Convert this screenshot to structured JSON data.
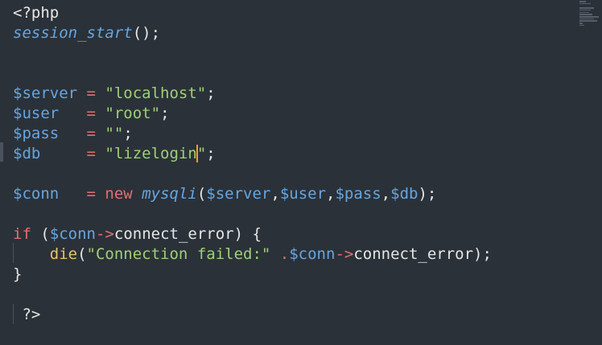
{
  "editor": {
    "lines": {
      "l1": {
        "tag": "<?php"
      },
      "l2": {
        "fn": "session_start",
        "rest": "();"
      },
      "l5": {
        "var": "$server",
        "op": " = ",
        "str": "\"localhost\"",
        "end": ";"
      },
      "l6": {
        "var": "$user",
        "pad": "   ",
        "op": "= ",
        "str": "\"root\"",
        "end": ";"
      },
      "l7": {
        "var": "$pass",
        "pad": "   ",
        "op": "= ",
        "str": "\"\"",
        "end": ";"
      },
      "l8": {
        "var": "$db",
        "pad": "     ",
        "op": "= ",
        "str_a": "\"lizelogin",
        "str_b": "\"",
        "end": ";"
      },
      "l10": {
        "var": "$conn",
        "pad": "   ",
        "op": "= ",
        "kw": "new ",
        "fn": "mysqli",
        "p1": "(",
        "a1": "$server",
        "c1": ",",
        "a2": "$user",
        "c2": ",",
        "a3": "$pass",
        "c3": ",",
        "a4": "$db",
        "p2": ");"
      },
      "l12": {
        "kw": "if",
        "p1": " (",
        "var": "$conn",
        "arrow": "->",
        "prop": "connect_error",
        "p2": ") {"
      },
      "l13": {
        "indent": "    ",
        "fn": "die",
        "p1": "(",
        "str": "\"Connection failed:\"",
        "sp": " ",
        "dot": ".",
        "var": "$conn",
        "arrow": "->",
        "prop": "connect_error",
        "p2": ");"
      },
      "l14": {
        "brace": "}"
      },
      "l16": {
        "indent": " ",
        "tag": "?>"
      }
    }
  }
}
